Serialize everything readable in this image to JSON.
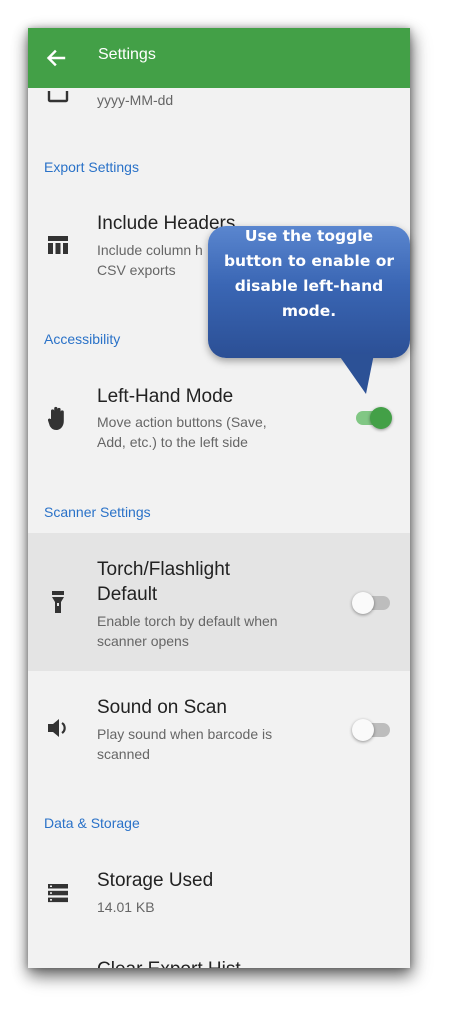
{
  "appbar": {
    "title": "Settings"
  },
  "date_format": {
    "value": "yyyy-MM-dd"
  },
  "sections": {
    "export": "Export Settings",
    "accessibility": "Accessibility",
    "scanner": "Scanner Settings",
    "data": "Data & Storage"
  },
  "include_headers": {
    "title": "Include Headers",
    "subtitle_line1": "Include column h",
    "subtitle_line2": "CSV exports"
  },
  "left_hand": {
    "title": "Left-Hand Mode",
    "subtitle_line1": "Move action buttons (Save,",
    "subtitle_line2": "Add, etc.) to the left side",
    "enabled": true
  },
  "torch": {
    "title_line1": "Torch/Flashlight",
    "title_line2": "Default",
    "subtitle_line1": "Enable torch by default when",
    "subtitle_line2": "scanner opens",
    "enabled": false
  },
  "sound": {
    "title": "Sound on Scan",
    "subtitle_line1": "Play sound when barcode is",
    "subtitle_line2": "scanned",
    "enabled": false
  },
  "storage": {
    "title": "Storage Used",
    "value": "14.01 KB"
  },
  "clear_history": {
    "title": "Clear Export Hist"
  },
  "callout": {
    "line1": "Use the toggle",
    "line2": "button to enable or",
    "line3": "disable left-hand",
    "line4": "mode."
  },
  "colors": {
    "appbar": "#43a047",
    "section": "#2a72c8",
    "callout": "#3a66b4",
    "toggle_on": "#43a047"
  }
}
